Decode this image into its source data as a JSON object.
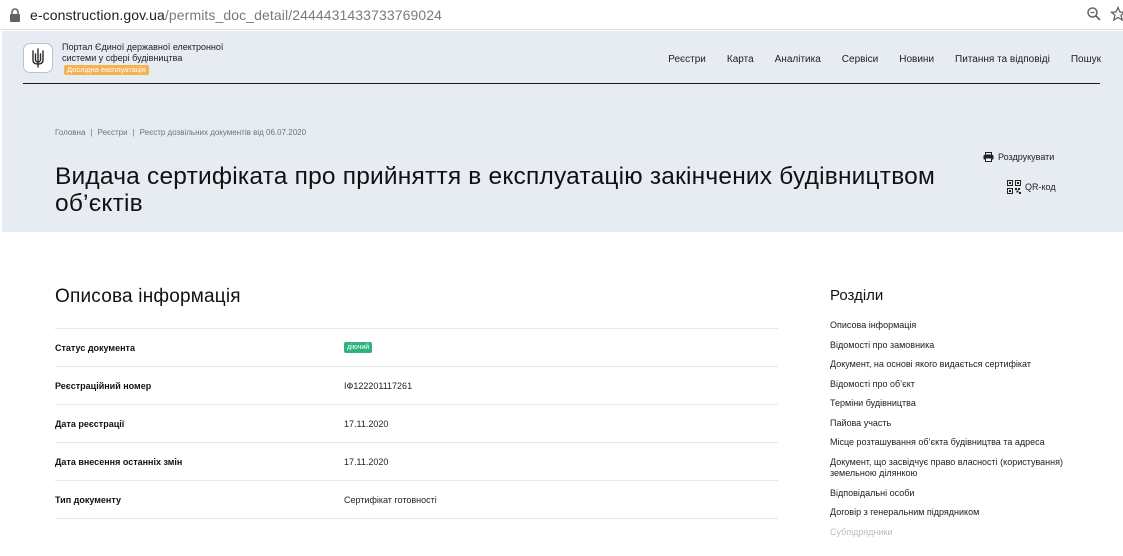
{
  "browser": {
    "url_host": "e-construction.gov.ua",
    "url_path": "/permits_doc_detail/2444431433733769024"
  },
  "header": {
    "logo_text": "Портал Єдиної державної електронної системи у сфері будівництва",
    "badge": "Дослідна експлуатація",
    "nav": [
      "Реєстри",
      "Карта",
      "Аналітика",
      "Сервіси",
      "Новини",
      "Питання та відповіді",
      "Пошук"
    ]
  },
  "breadcrumb": [
    "Головна",
    "Реєстри",
    "Реєстр дозвільних документів від 06.07.2020"
  ],
  "page_title": "Видача сертифіката про прийняття в експлуатацію закінчених будівництвом об’єктів",
  "actions": {
    "print": "Роздрукувати",
    "qr": "QR-код"
  },
  "section": {
    "title": "Описова інформація",
    "rows": [
      {
        "label": "Статус документа",
        "value": "діючий"
      },
      {
        "label": "Реєстраційний номер",
        "value": "ІФ122201117261"
      },
      {
        "label": "Дата реєстрації",
        "value": "17.11.2020"
      },
      {
        "label": "Дата внесення останніх змін",
        "value": "17.11.2020"
      },
      {
        "label": "Тип документу",
        "value": "Сертифікат готовності"
      }
    ]
  },
  "toc": {
    "title": "Розділи",
    "items": [
      "Описова інформація",
      "Відомості про замовника",
      "Документ, на основі якого видається сертифікат",
      "Відомості про об’єкт",
      "Терміни будівництва",
      "Пайова участь",
      "Місце розташування об’єкта будівництва та адреса",
      "Документ, що засвідчує право власності (користування) земельною ділянкою",
      "Відповідальні особи",
      "Договір з генеральним підрядником",
      "Субпідрядники"
    ]
  },
  "colors": {
    "hero_bg": "#e6ecf2",
    "status_green": "#2fb27e",
    "badge_orange": "#f4b353"
  }
}
